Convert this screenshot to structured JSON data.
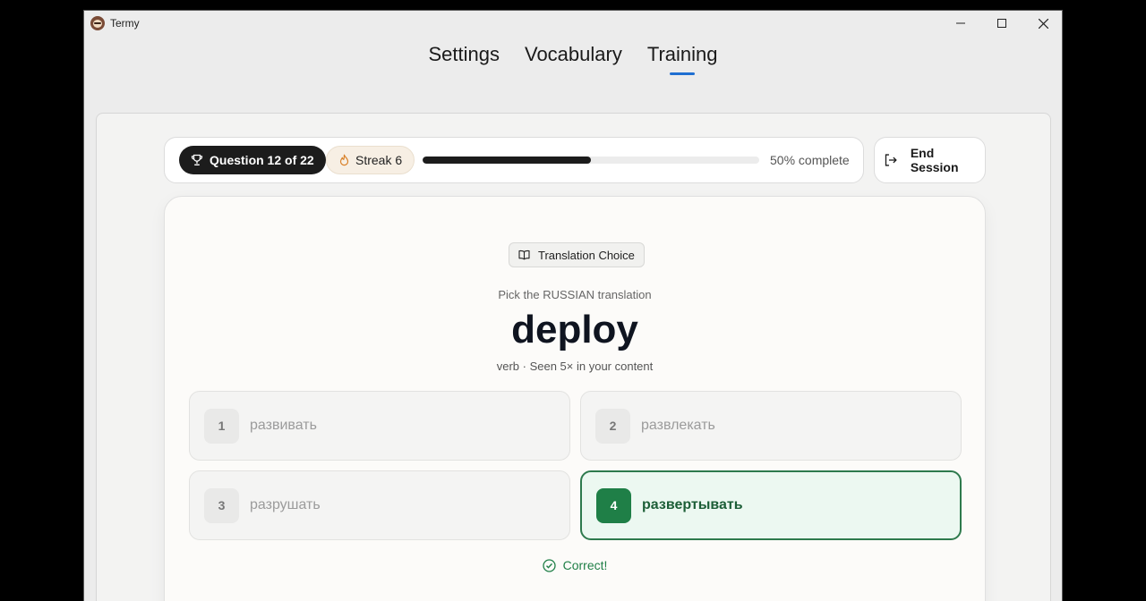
{
  "window": {
    "title": "Termy",
    "app_icon": "sloth-logo-icon"
  },
  "nav": {
    "tabs": [
      {
        "label": "Settings"
      },
      {
        "label": "Vocabulary"
      },
      {
        "label": "Training",
        "active": true
      }
    ]
  },
  "session": {
    "question_label": "Question 12 of 22",
    "streak_label": "Streak 6",
    "progress": 0.5,
    "progress_text": "50% complete",
    "end_label": "End Session"
  },
  "card": {
    "type_label": "Translation Choice",
    "prompt": "Pick the RUSSIAN translation",
    "word": "deploy",
    "meta": "verb · Seen 5× in your content",
    "options": [
      {
        "num": "1",
        "text": "развивать"
      },
      {
        "num": "2",
        "text": "развлекать"
      },
      {
        "num": "3",
        "text": "разрушать"
      },
      {
        "num": "4",
        "text": "развертывать",
        "state": "correct"
      }
    ],
    "feedback": "Correct!"
  },
  "colors": {
    "accent": "#1f6fd1",
    "success": "#1f7f47",
    "success_bg": "#ecf8f1"
  }
}
